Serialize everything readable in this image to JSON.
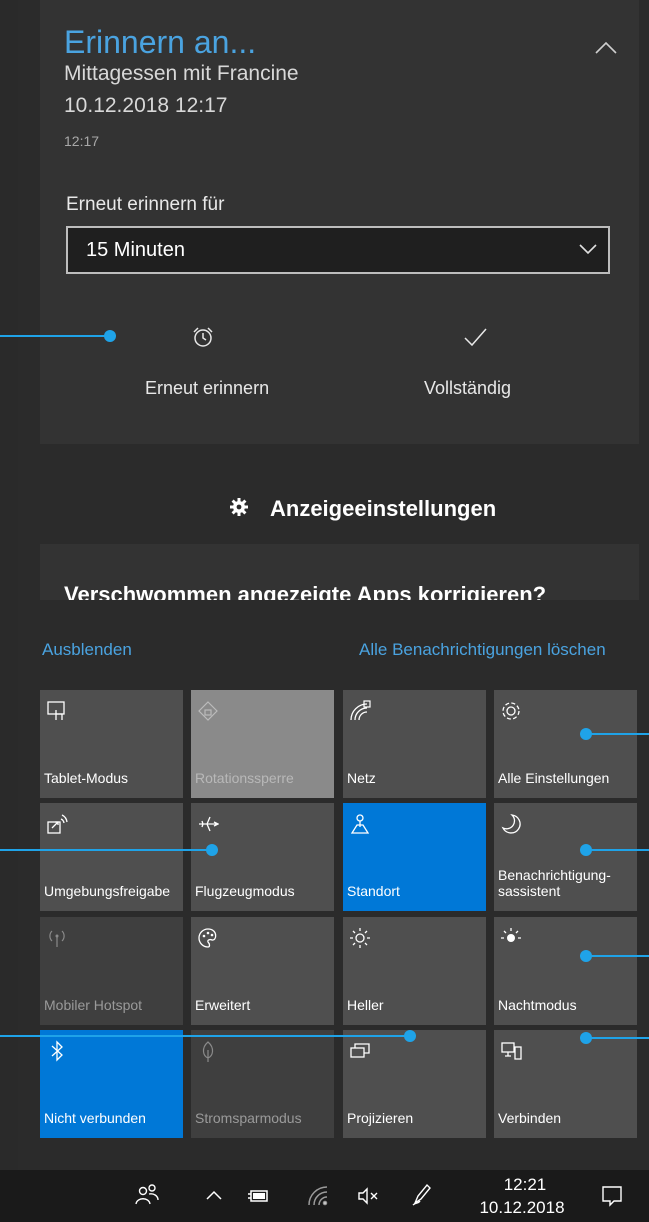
{
  "reminder": {
    "title": "Erinnern an...",
    "subject": "Mittagessen mit Francine",
    "datetime": "10.12.2018 12:17",
    "time_small": "12:17",
    "snooze_label": "Erneut erinnern für",
    "snooze_value": "15 Minuten",
    "snooze_button": "Erneut erinnern",
    "done_button": "Vollständig"
  },
  "display_settings": {
    "label": "Anzeigeeinstellungen"
  },
  "notification": {
    "text": "Verschwommen angezeigte Apps korrigieren?"
  },
  "action_center": {
    "collapse_label": "Ausblenden",
    "clear_all_label": "Alle Benachrichtigungen löschen",
    "tiles": [
      {
        "label": "Tablet-Modus",
        "state": "off",
        "icon": "tablet-mode-icon"
      },
      {
        "label": "Rotationssperre",
        "state": "light",
        "icon": "rotation-lock-icon"
      },
      {
        "label": "Netz",
        "state": "off",
        "icon": "network-icon"
      },
      {
        "label": "Alle Einstellungen",
        "state": "off",
        "icon": "settings-gear-icon"
      },
      {
        "label": "Umgebungsfreigabe",
        "state": "off",
        "icon": "nearby-share-icon"
      },
      {
        "label": "Flugzeugmodus",
        "state": "off",
        "icon": "airplane-icon"
      },
      {
        "label": "Standort",
        "state": "on",
        "icon": "location-icon"
      },
      {
        "label": "Benachrichtigung-\nsassistent",
        "state": "off",
        "icon": "moon-icon"
      },
      {
        "label": "Mobiler Hotspot",
        "state": "disabled",
        "icon": "hotspot-icon"
      },
      {
        "label": "Erweitert",
        "state": "off",
        "icon": "palette-icon"
      },
      {
        "label": "Heller",
        "state": "off",
        "icon": "brightness-icon"
      },
      {
        "label": "Nachtmodus",
        "state": "off",
        "icon": "night-light-icon"
      },
      {
        "label": "Nicht verbunden",
        "state": "on",
        "icon": "bluetooth-icon"
      },
      {
        "label": "Stromsparmodus",
        "state": "disabled",
        "icon": "battery-saver-icon"
      },
      {
        "label": "Projizieren",
        "state": "off",
        "icon": "project-icon"
      },
      {
        "label": "Verbinden",
        "state": "off",
        "icon": "connect-icon"
      }
    ]
  },
  "taskbar": {
    "time": "12:21",
    "date": "10.12.2018",
    "icons": [
      "people-icon",
      "chevron-up-icon",
      "battery-icon",
      "wifi-icon",
      "volume-muted-icon",
      "pen-icon",
      "action-center-icon"
    ]
  },
  "colors": {
    "accent": "#0078d7",
    "link": "#4aa3e0",
    "callout": "#1fa3e8"
  }
}
